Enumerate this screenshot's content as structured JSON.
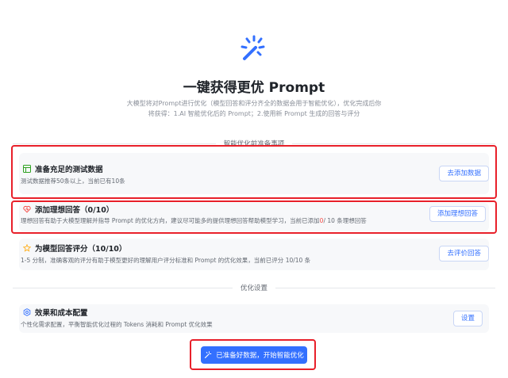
{
  "header": {
    "icon": "magic-wand-icon",
    "title": "一键获得更优 Prompt",
    "desc_line1": "大模型将对Prompt进行优化（模型回答和评分齐全的数据会用于智能优化），优化完成后你",
    "desc_line2": "将获得：1.AI 智能优化后的 Prompt；2.使用新 Prompt 生成的回答与评分"
  },
  "prep_section": {
    "label": "智能优化前准备事项"
  },
  "cards": [
    {
      "icon": "table-icon",
      "title": "准备充足的测试数据",
      "desc": "测试数据推荐50条以上，当前已有10条",
      "button": "去添加数据"
    },
    {
      "icon": "heart-icon",
      "title": "添加理想回答（0/10）",
      "desc_before": "理想回答有助于大模型理解并指导 Prompt 的优化方向，建议尽可能多的提供理想回答帮助模型学习，当前已添加",
      "desc_count": "0",
      "desc_after": "/ 10 条理想回答",
      "button": "添加理想回答"
    },
    {
      "icon": "star-icon",
      "title": "为模型回答评分（10/10）",
      "desc": "1-5 分制，准确客观的评分有助于模型更好的理解用户评分标准和 Prompt 的优化效果，当前已评分 10/10 条",
      "button": "去评价回答"
    }
  ],
  "settings_section": {
    "label": "优化设置"
  },
  "settings_card": {
    "icon": "settings-icon",
    "title": "效果和成本配置",
    "desc": "个性化需求配置，平衡智能优化过程的 Tokens 消耗和 Prompt 优化效果",
    "button": "设置"
  },
  "primary_action": {
    "icon": "sparkle-icon",
    "label": "已准备好数据，开始智能优化"
  },
  "colors": {
    "accent": "#3370ff",
    "highlight": "#e8202a",
    "warning": "#f54a45",
    "card_bg": "#f7f8fa"
  }
}
